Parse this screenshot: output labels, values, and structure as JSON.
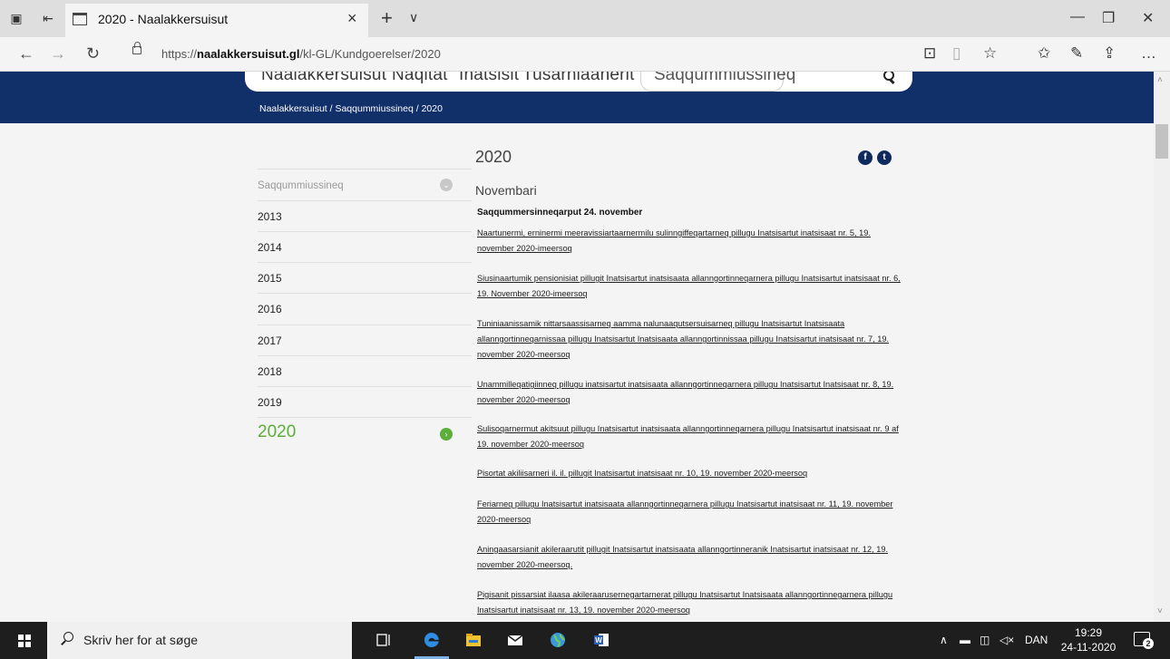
{
  "browser": {
    "tab_title": "2020 - Naalakkersuisut",
    "url_prefix": "https://",
    "url_domain": "naalakkersuisut.gl",
    "url_path": "/kl-GL/Kundgoerelser/2020"
  },
  "site": {
    "nav": [
      "Naalakkersuisut",
      "Naqitat",
      "Inatsisit",
      "Tusarniaanerit"
    ],
    "search_value": "Saqqummiussineq",
    "breadcrumb": "Naalakkersuisut / Saqqummiussineq  / 2020"
  },
  "sidebar": {
    "header": "Saqqummiussineq",
    "years": [
      "2013",
      "2014",
      "2015",
      "2016",
      "2017",
      "2018",
      "2019",
      "2020"
    ],
    "active_year": "2020"
  },
  "content": {
    "title": "2020",
    "month": "Novembari",
    "subheading": "Saqqummersinneqarput 24. november",
    "items": [
      "Naartunermi, erninermi meeravissiartaarnermilu sulinngiffeqartarneq pillugu Inatsisartut inatsisaat nr. 5, 19. november 2020-imeersoq",
      "Siusinaartumik pensionisiat pillugit Inatsisartut inatsisaata allanngortinneqarnera pillugu Inatsisartut inatsisaat nr. 6, 19. November 2020-imeersoq",
      "Tuniniaanissamik nittarsaassisarneq aamma nalunaaqutsersuisarneq pillugu Inatsisartut Inatsisaata allanngortinneqarnissaa pillugu Inatsisartut Inatsisaata allanngortinnissaa pillugu Inatsisartut inatsisaat nr. 7, 19. november 2020-meersoq",
      "Unammilleqatigiinneq pillugu inatsisartut inatsisaata allanngortinneqarnera pillugu Inatsisartut Inatsisaat nr. 8, 19. november 2020-meersoq",
      "Sulisoqarnermut akitsuut pillugu Inatsisartut inatsisaata allanngortinneqarnera pillugu Inatsisartut inatsisaat nr. 9 af 19. november 2020-meersoq",
      "Pisortat akiliisarneri il. il. pillugit Inatsisartut inatsisaat nr. 10, 19. november 2020-meersoq",
      "Feriarneq pillugu Inatsisartut inatsisaata allanngortinneqarnera pillugu Inatsisartut inatsisaat nr. 11, 19. november 2020-meersoq",
      "Aningaasarsianit akileraarutit pillugit Inatsisartut inatsisaata allanngortinneranik Inatsisartut inatsisaat nr. 12, 19. november 2020-meersoq.",
      "Pigisanit pissarsiat ilaasa akileraarusernegartarnerat pillugu Inatsisartut Inatsisaata allanngortinnegarnera pillugu Inatsisartut inatsisaat nr. 13, 19. november 2020-meersoq"
    ]
  },
  "taskbar": {
    "search_placeholder": "Skriv her for at søge",
    "language": "DAN",
    "time": "19:29",
    "date": "24-11-2020",
    "notification_count": "2"
  },
  "colors": {
    "header_blue": "#11306a",
    "accent_green": "#5cae3a"
  }
}
